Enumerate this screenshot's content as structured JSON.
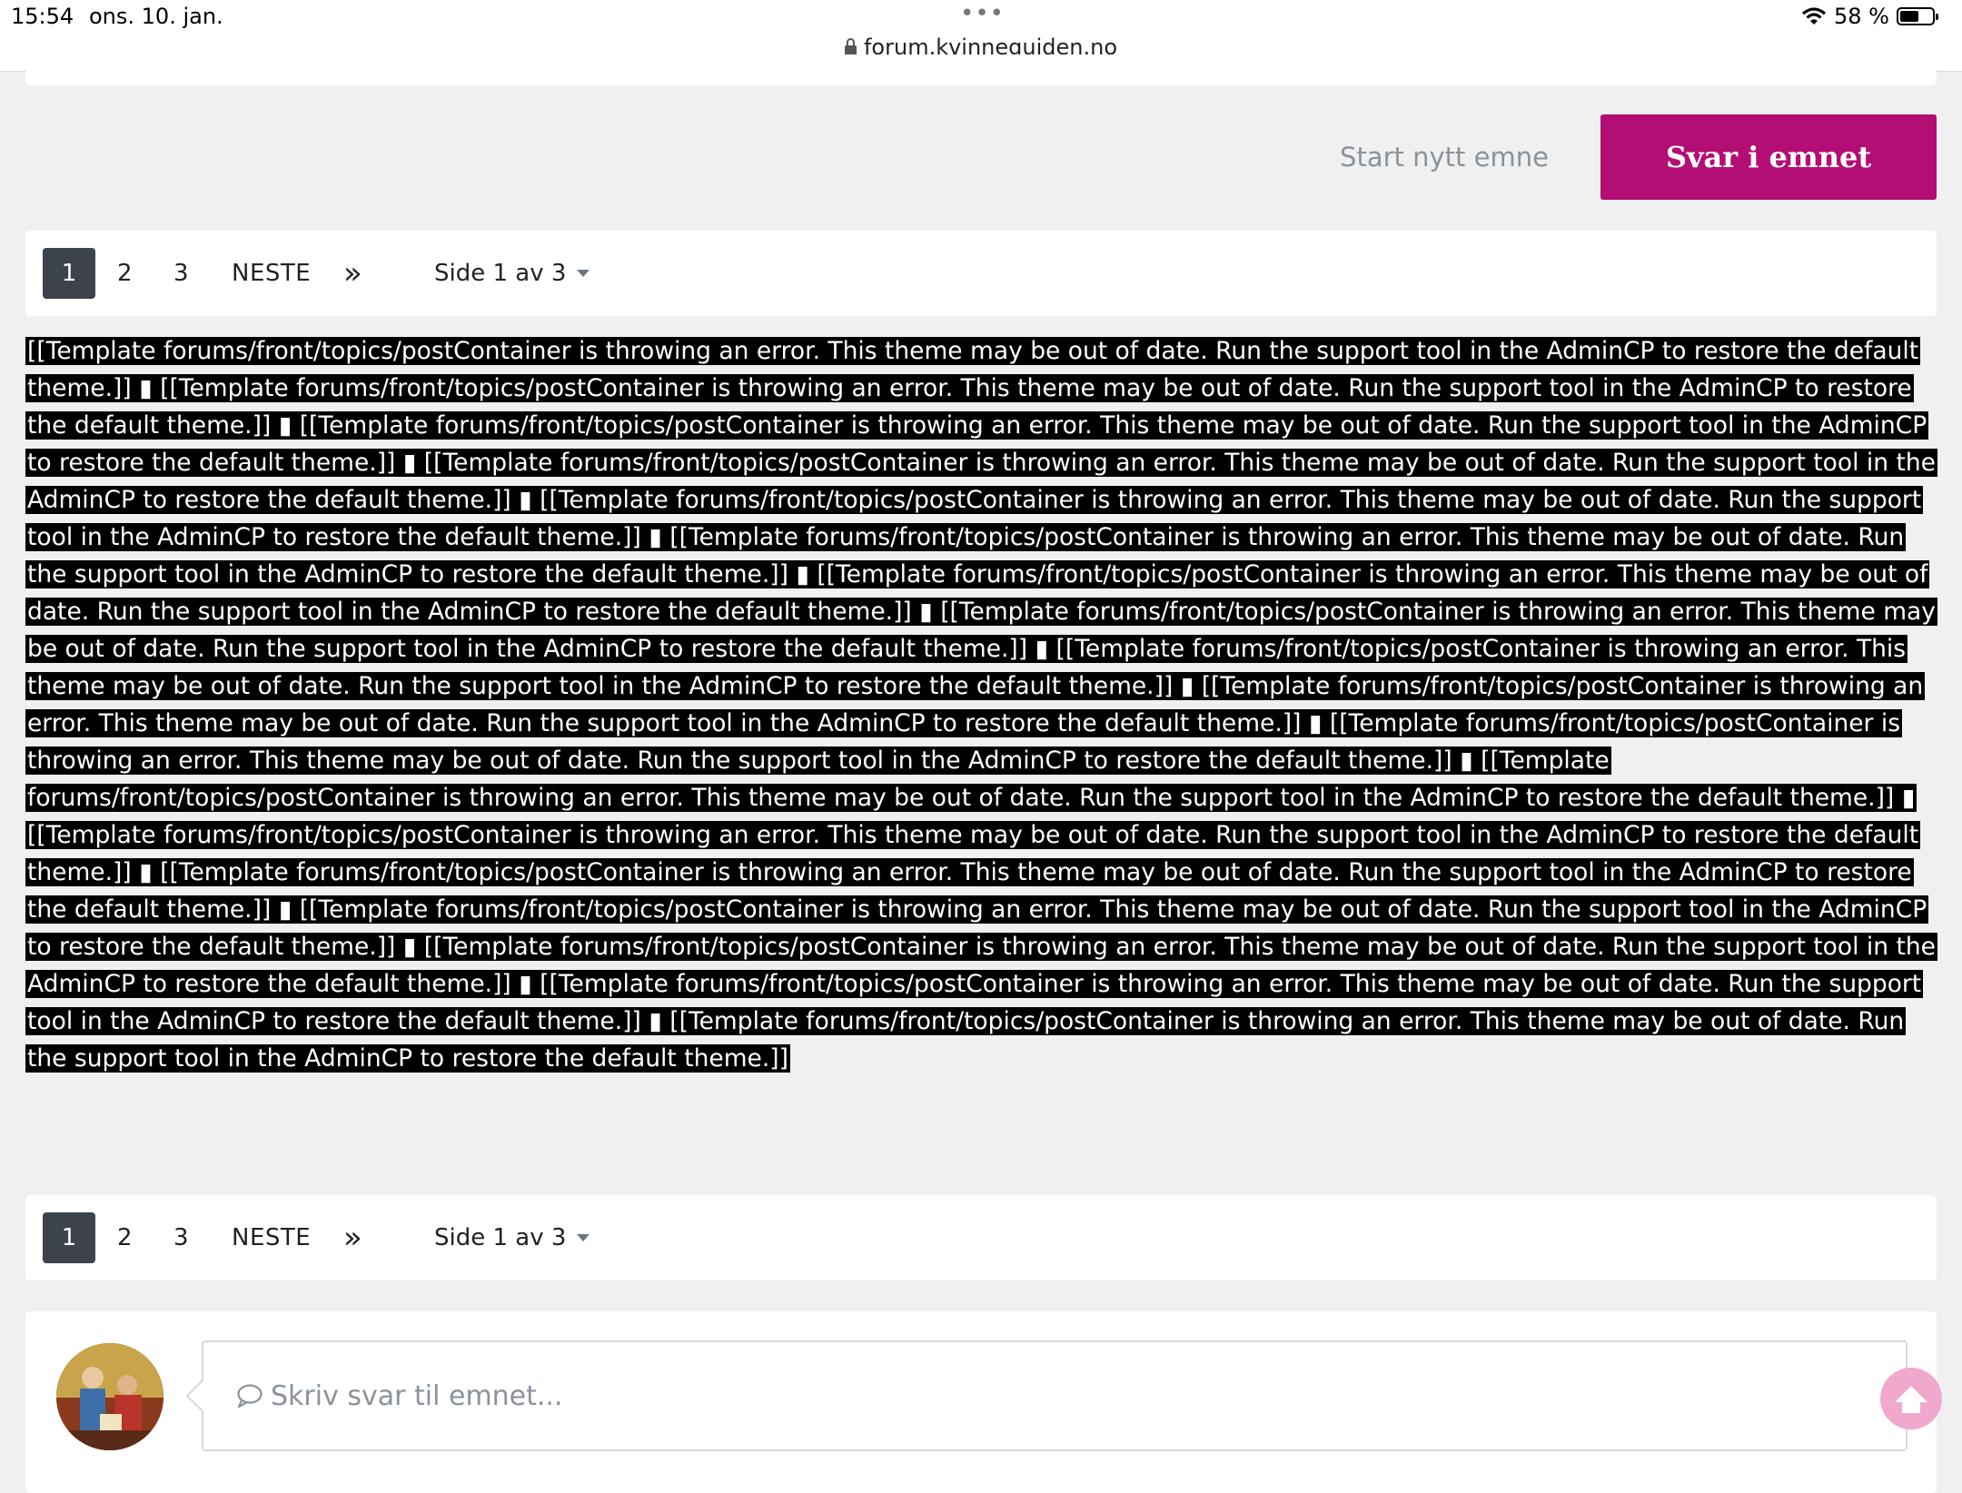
{
  "status_bar": {
    "time": "15:54",
    "date": "ons. 10. jan.",
    "dots": "•••",
    "url": "forum.kvinneguiden.no",
    "battery": "58 %",
    "battery_level": 0.58
  },
  "actions": {
    "start_label": "Start nytt emne",
    "reply_label": "Svar i emnet",
    "accent_color": "#b30e74"
  },
  "pagination": {
    "active_page": "1",
    "pages": [
      "2",
      "3"
    ],
    "next_label": "NESTE",
    "last_symbol": "»",
    "page_select": "Side 1 av 3"
  },
  "error": {
    "text": "[[Template forums/front/topics/postContainer is throwing an error. This theme may be out of date. Run the support tool in the AdminCP to restore the default theme.]] ▮ [[Template forums/front/topics/postContainer is throwing an error. This theme may be out of date. Run the support tool in the AdminCP to restore the default theme.]] ▮ [[Template forums/front/topics/postContainer is throwing an error. This theme may be out of date. Run the support tool in the AdminCP to restore the default theme.]] ▮ [[Template forums/front/topics/postContainer is throwing an error. This theme may be out of date. Run the support tool in the AdminCP to restore the default theme.]] ▮ [[Template forums/front/topics/postContainer is throwing an error. This theme may be out of date. Run the support tool in the AdminCP to restore the default theme.]] ▮ [[Template forums/front/topics/postContainer is throwing an error. This theme may be out of date. Run the support tool in the AdminCP to restore the default theme.]] ▮ [[Template forums/front/topics/postContainer is throwing an error. This theme may be out of date. Run the support tool in the AdminCP to restore the default theme.]] ▮ [[Template forums/front/topics/postContainer is throwing an error. This theme may be out of date. Run the support tool in the AdminCP to restore the default theme.]] ▮ [[Template forums/front/topics/postContainer is throwing an error. This theme may be out of date. Run the support tool in the AdminCP to restore the default theme.]] ▮ [[Template forums/front/topics/postContainer is throwing an error. This theme may be out of date. Run the support tool in the AdminCP to restore the default theme.]] ▮ [[Template forums/front/topics/postContainer is throwing an error. This theme may be out of date. Run the support tool in the AdminCP to restore the default theme.]] ▮ [[Template forums/front/topics/postContainer is throwing an error. This theme may be out of date. Run the support tool in the AdminCP to restore the default theme.]] ▮ [[Template forums/front/topics/postContainer is throwing an error. This theme may be out of date. Run the support tool in the AdminCP to restore the default theme.]] ▮ [[Template forums/front/topics/postContainer is throwing an error. This theme may be out of date. Run the support tool in the AdminCP to restore the default theme.]] ▮ [[Template forums/front/topics/postContainer is throwing an error. This theme may be out of date. Run the support tool in the AdminCP to restore the default theme.]] ▮ [[Template forums/front/topics/postContainer is throwing an error. This theme may be out of date. Run the support tool in the AdminCP to restore the default theme.]] ▮ [[Template forums/front/topics/postContainer is throwing an error. This theme may be out of date. Run the support tool in the AdminCP to restore the default theme.]] ▮ [[Template forums/front/topics/postContainer is throwing an error. This theme may be out of date. Run the support tool in the AdminCP to restore the default theme.]]"
  },
  "reply": {
    "placeholder": "Skriv svar til emnet..."
  }
}
